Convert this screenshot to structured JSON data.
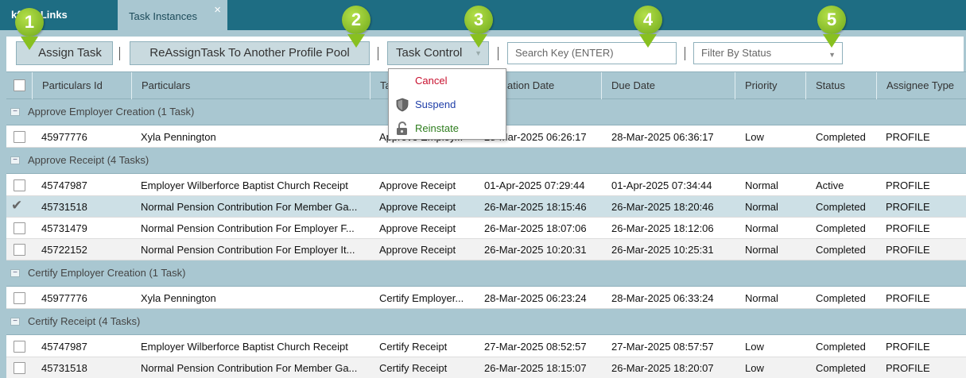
{
  "tabs": {
    "workflow_label": "kflow Links",
    "task_instances_label": "Task Instances",
    "close_glyph": "×"
  },
  "toolbar": {
    "assign_label": "Assign Task",
    "reassign_label": "ReAssignTask To Another Profile Pool",
    "task_control_label": "Task Control",
    "search_placeholder": "Search Key (ENTER)",
    "filter_placeholder": "Filter By Status"
  },
  "task_control_menu": [
    {
      "label": "Cancel",
      "icon": "none",
      "color": "#c8102e"
    },
    {
      "label": "Suspend",
      "icon": "shield-icon",
      "color": "#1f3ea8"
    },
    {
      "label": "Reinstate",
      "icon": "unlock-icon",
      "color": "#2e7d1e"
    }
  ],
  "columns": {
    "particulars_id": "Particulars Id",
    "particulars": "Particulars",
    "task": "Ta",
    "creation_date": "ation Date",
    "due_date": "Due Date",
    "priority": "Priority",
    "status": "Status",
    "assignee_type": "Assignee Type"
  },
  "groups": [
    {
      "label": "Approve Employer Creation (1 Task)",
      "rows": [
        {
          "id": "45977776",
          "particulars": "Xyla Pennington",
          "task": "Approve Employ...",
          "created": "28-Mar-2025 06:26:17",
          "due": "28-Mar-2025 06:36:17",
          "priority": "Low",
          "status": "Completed",
          "assignee": "PROFILE",
          "checked": false,
          "selected": false
        }
      ]
    },
    {
      "label": "Approve Receipt (4 Tasks)",
      "rows": [
        {
          "id": "45747987",
          "particulars": "Employer Wilberforce Baptist Church Receipt",
          "task": "Approve Receipt",
          "created": "01-Apr-2025 07:29:44",
          "due": "01-Apr-2025 07:34:44",
          "priority": "Normal",
          "status": "Active",
          "assignee": "PROFILE",
          "checked": false,
          "selected": false
        },
        {
          "id": "45731518",
          "particulars": "Normal Pension Contribution For Member Ga...",
          "task": "Approve Receipt",
          "created": "26-Mar-2025 18:15:46",
          "due": "26-Mar-2025 18:20:46",
          "priority": "Normal",
          "status": "Completed",
          "assignee": "PROFILE",
          "checked": true,
          "selected": true
        },
        {
          "id": "45731479",
          "particulars": "Normal Pension Contribution For Employer F...",
          "task": "Approve Receipt",
          "created": "26-Mar-2025 18:07:06",
          "due": "26-Mar-2025 18:12:06",
          "priority": "Normal",
          "status": "Completed",
          "assignee": "PROFILE",
          "checked": false,
          "selected": false
        },
        {
          "id": "45722152",
          "particulars": "Normal Pension Contribution For Employer It...",
          "task": "Approve Receipt",
          "created": "26-Mar-2025 10:20:31",
          "due": "26-Mar-2025 10:25:31",
          "priority": "Normal",
          "status": "Completed",
          "assignee": "PROFILE",
          "checked": false,
          "selected": false
        }
      ]
    },
    {
      "label": "Certify Employer Creation (1 Task)",
      "rows": [
        {
          "id": "45977776",
          "particulars": "Xyla Pennington",
          "task": "Certify Employer...",
          "created": "28-Mar-2025 06:23:24",
          "due": "28-Mar-2025 06:33:24",
          "priority": "Normal",
          "status": "Completed",
          "assignee": "PROFILE",
          "checked": false,
          "selected": false
        }
      ]
    },
    {
      "label": "Certify Receipt (4 Tasks)",
      "rows": [
        {
          "id": "45747987",
          "particulars": "Employer Wilberforce Baptist Church Receipt",
          "task": "Certify Receipt",
          "created": "27-Mar-2025 08:52:57",
          "due": "27-Mar-2025 08:57:57",
          "priority": "Low",
          "status": "Completed",
          "assignee": "PROFILE",
          "checked": false,
          "selected": false
        },
        {
          "id": "45731518",
          "particulars": "Normal Pension Contribution For Member Ga...",
          "task": "Certify Receipt",
          "created": "26-Mar-2025 18:15:07",
          "due": "26-Mar-2025 18:20:07",
          "priority": "Low",
          "status": "Completed",
          "assignee": "PROFILE",
          "checked": false,
          "selected": false
        }
      ]
    }
  ],
  "callouts": [
    "1",
    "2",
    "3",
    "4",
    "5"
  ],
  "colors": {
    "header_bar": "#1e6d83",
    "panel": "#a9c7d1",
    "callout": "#88c020"
  }
}
